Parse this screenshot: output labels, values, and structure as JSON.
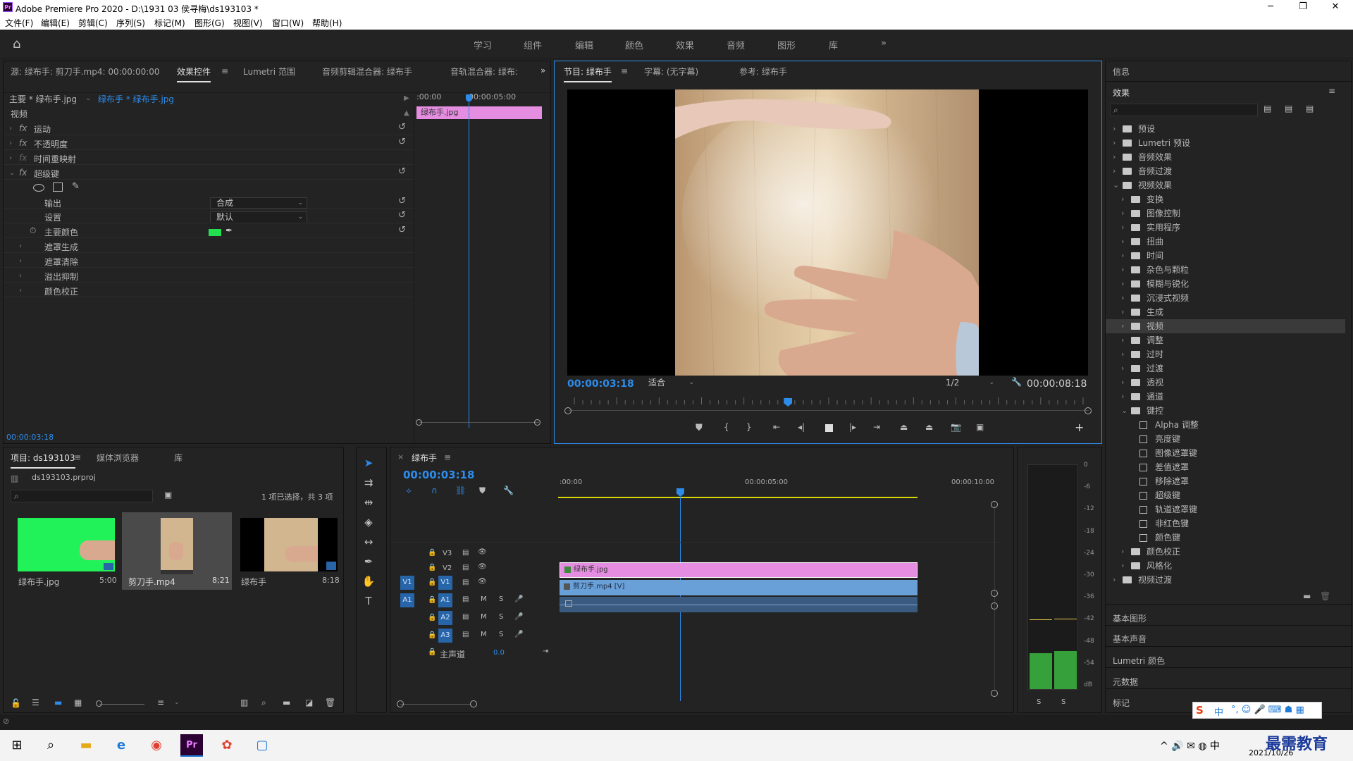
{
  "window": {
    "title": "Adobe Premiere Pro 2020 - D:\\1931 03 侯寻梅\\ds193103 *",
    "app_badge": "Pr",
    "minimize": "─",
    "maximize": "❐",
    "close": "✕"
  },
  "menu": [
    "文件(F)",
    "编辑(E)",
    "剪辑(C)",
    "序列(S)",
    "标记(M)",
    "图形(G)",
    "视图(V)",
    "窗口(W)",
    "帮助(H)"
  ],
  "workspaces": [
    "学习",
    "组件",
    "编辑",
    "颜色",
    "效果",
    "音频",
    "图形",
    "库",
    "»"
  ],
  "source_panel": {
    "tabs": [
      "源: 绿布手: 剪刀手.mp4: 00:00:00:00",
      "效果控件",
      "Lumetri 范围",
      "音频剪辑混合器: 绿布手",
      "音轨混合器: 绿布:"
    ],
    "more": "»",
    "master_clip": "主要 * 绿布手.jpg",
    "seq_clip": "绿布手 * 绿布手.jpg",
    "ruler_start": ":00:00",
    "ruler_mid": "00:00:05:00",
    "clip_label": "绿布手.jpg",
    "section": "视频",
    "effects": [
      {
        "name": "运动"
      },
      {
        "name": "不透明度"
      },
      {
        "name": "时间重映射"
      },
      {
        "name": "超级键"
      }
    ],
    "ultra_key": {
      "output_label": "输出",
      "output_value": "合成",
      "setting_label": "设置",
      "setting_value": "默认",
      "key_color_label": "主要颜色",
      "key_color": "#22e050"
    },
    "subgroups": [
      "遮罩生成",
      "遮罩清除",
      "溢出抑制",
      "颜色校正"
    ],
    "timecode": "00:00:03:18"
  },
  "program": {
    "tabs": [
      "节目: 绿布手",
      "字幕: (无字幕)",
      "参考: 绿布手"
    ],
    "timecode": "00:00:03:18",
    "fit": "适合",
    "resolution": "1/2",
    "duration": "00:00:08:18",
    "progress": 0.42
  },
  "info_panel": {
    "title": "信息"
  },
  "effects_panel": {
    "title": "效果",
    "tree": [
      {
        "label": "预设",
        "level": 0,
        "type": "folder"
      },
      {
        "label": "Lumetri 预设",
        "level": 0,
        "type": "folder"
      },
      {
        "label": "音频效果",
        "level": 0,
        "type": "folder"
      },
      {
        "label": "音频过渡",
        "level": 0,
        "type": "folder"
      },
      {
        "label": "视频效果",
        "level": 0,
        "type": "folder",
        "open": true
      },
      {
        "label": "变换",
        "level": 1,
        "type": "folder"
      },
      {
        "label": "图像控制",
        "level": 1,
        "type": "folder"
      },
      {
        "label": "实用程序",
        "level": 1,
        "type": "folder"
      },
      {
        "label": "扭曲",
        "level": 1,
        "type": "folder"
      },
      {
        "label": "时间",
        "level": 1,
        "type": "folder"
      },
      {
        "label": "杂色与颗粒",
        "level": 1,
        "type": "folder"
      },
      {
        "label": "模糊与锐化",
        "level": 1,
        "type": "folder"
      },
      {
        "label": "沉浸式视频",
        "level": 1,
        "type": "folder"
      },
      {
        "label": "生成",
        "level": 1,
        "type": "folder"
      },
      {
        "label": "视频",
        "level": 1,
        "type": "folder",
        "selected": true
      },
      {
        "label": "调整",
        "level": 1,
        "type": "folder"
      },
      {
        "label": "过时",
        "level": 1,
        "type": "folder"
      },
      {
        "label": "过渡",
        "level": 1,
        "type": "folder"
      },
      {
        "label": "透视",
        "level": 1,
        "type": "folder"
      },
      {
        "label": "通道",
        "level": 1,
        "type": "folder"
      },
      {
        "label": "键控",
        "level": 1,
        "type": "folder",
        "open": true
      },
      {
        "label": "Alpha 调整",
        "level": 2,
        "type": "preset"
      },
      {
        "label": "亮度键",
        "level": 2,
        "type": "preset"
      },
      {
        "label": "图像遮罩键",
        "level": 2,
        "type": "preset"
      },
      {
        "label": "差值遮罩",
        "level": 2,
        "type": "preset"
      },
      {
        "label": "移除遮罩",
        "level": 2,
        "type": "preset"
      },
      {
        "label": "超级键",
        "level": 2,
        "type": "preset"
      },
      {
        "label": "轨道遮罩键",
        "level": 2,
        "type": "preset"
      },
      {
        "label": "非红色键",
        "level": 2,
        "type": "preset"
      },
      {
        "label": "颜色键",
        "level": 2,
        "type": "preset"
      },
      {
        "label": "颜色校正",
        "level": 1,
        "type": "folder"
      },
      {
        "label": "风格化",
        "level": 1,
        "type": "folder"
      },
      {
        "label": "视频过渡",
        "level": 0,
        "type": "folder"
      }
    ],
    "sections": [
      "基本图形",
      "基本声音",
      "Lumetri 颜色",
      "元数据",
      "标记"
    ]
  },
  "project": {
    "tabs": [
      "项目: ds193103",
      "媒体浏览器",
      "库"
    ],
    "file": "ds193103.prproj",
    "selection": "1 项已选择，共 3 项",
    "items": [
      {
        "name": "绿布手.jpg",
        "dur": "5:00"
      },
      {
        "name": "剪刀手.mp4",
        "dur": "8;21"
      },
      {
        "name": "绿布手",
        "dur": "8:18"
      }
    ]
  },
  "timeline": {
    "tab": "绿布手",
    "timecode": "00:00:03:18",
    "ruler": [
      ":00:00",
      "00:00:05:00",
      "00:00:10:00"
    ],
    "tracks": [
      "V3",
      "V2",
      "V1",
      "A1",
      "A2",
      "A3"
    ],
    "master": "主声道",
    "master_val": "0.0",
    "clips": {
      "v2": "绿布手.jpg",
      "v1": "剪刀手.mp4 [V]"
    },
    "playhead": 0.368
  },
  "meter": {
    "scale": [
      "0",
      "-6",
      "-12",
      "-18",
      "-24",
      "-30",
      "-36",
      "-42",
      "-48",
      "-54",
      "dB"
    ],
    "solo": [
      "S",
      "S"
    ]
  },
  "taskbar": {
    "date": "2021/10/26",
    "ime": "中",
    "watermark": "最需教育"
  }
}
